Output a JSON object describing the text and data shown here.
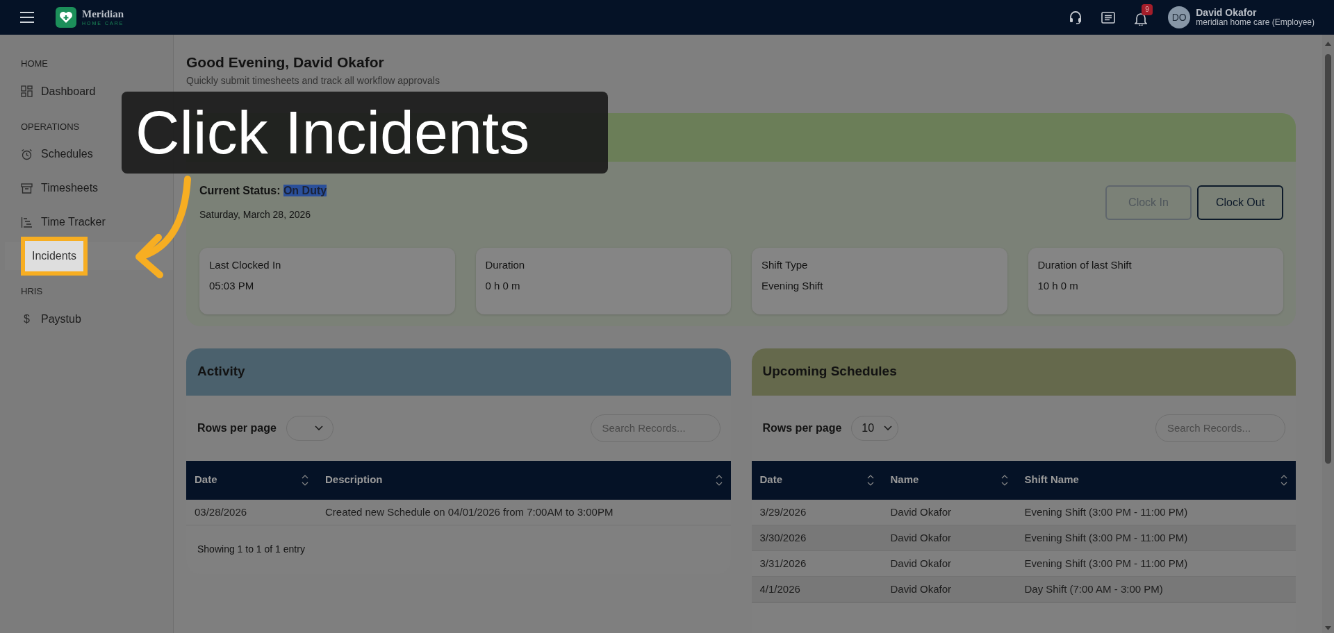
{
  "topbar": {
    "brand": "Meridian",
    "brand_sub": "HOME CARE",
    "notification_count": "9",
    "user": {
      "initials": "DO",
      "name": "David Okafor",
      "org": "meridian home care (Employee)"
    }
  },
  "sidebar": {
    "sections": [
      {
        "heading": "HOME",
        "items": [
          {
            "label": "Dashboard",
            "selected": false
          }
        ]
      },
      {
        "heading": "OPERATIONS",
        "items": [
          {
            "label": "Schedules",
            "selected": false
          },
          {
            "label": "Timesheets",
            "selected": false
          },
          {
            "label": "Time Tracker",
            "selected": false
          },
          {
            "label": "Incidents",
            "selected": true
          }
        ]
      },
      {
        "heading": "HRIS",
        "items": [
          {
            "label": "Paystub",
            "glyph": "$",
            "selected": false
          }
        ]
      }
    ]
  },
  "greeting": {
    "title": "Good Evening, David Okafor",
    "subtitle": "Quickly submit timesheets and track all workflow approvals"
  },
  "time_tracker": {
    "status_label": "Current Status:",
    "status": {
      "text": "On Duty",
      "selected": true
    },
    "date": "Saturday, March 28, 2026",
    "buttons": [
      {
        "label": "Clock In",
        "disabled": true
      },
      {
        "label": "Clock Out",
        "disabled": false
      }
    ],
    "stats": [
      {
        "label": "Last Clocked In",
        "value": "05:03 PM"
      },
      {
        "label": "Duration",
        "value": "0 h 0 m"
      },
      {
        "label": "Shift Type",
        "value": "Evening Shift"
      },
      {
        "label": "Duration of last Shift",
        "value": "10 h 0 m"
      }
    ]
  },
  "activity": {
    "title": "Activity",
    "rows_per_page_label": "Rows per page",
    "search_placeholder": "Search Records...",
    "columns": [
      "Date",
      "Description"
    ],
    "rows": [
      [
        "03/28/2026",
        "Created new Schedule on 04/01/2026 from 7:00AM to 3:00PM"
      ]
    ],
    "footer": "Showing 1 to 1 of 1 entry"
  },
  "upcoming": {
    "title": "Upcoming Schedules",
    "rows_per_page_label": "Rows per page",
    "rows_per_page": "10",
    "search_placeholder": "Search Records...",
    "columns": [
      "Date",
      "Name",
      "Shift Name"
    ],
    "rows": [
      [
        "3/29/2026",
        "David Okafor",
        "Evening Shift (3:00 PM - 11:00 PM)"
      ],
      [
        "3/30/2026",
        "David Okafor",
        "Evening Shift (3:00 PM - 11:00 PM)"
      ],
      [
        "3/31/2026",
        "David Okafor",
        "Evening Shift (3:00 PM - 11:00 PM)"
      ],
      [
        "4/1/2026",
        "David Okafor",
        "Day Shift (7:00 AM - 3:00 PM)"
      ]
    ]
  },
  "tutorial": {
    "callout": "Click Incidents"
  }
}
